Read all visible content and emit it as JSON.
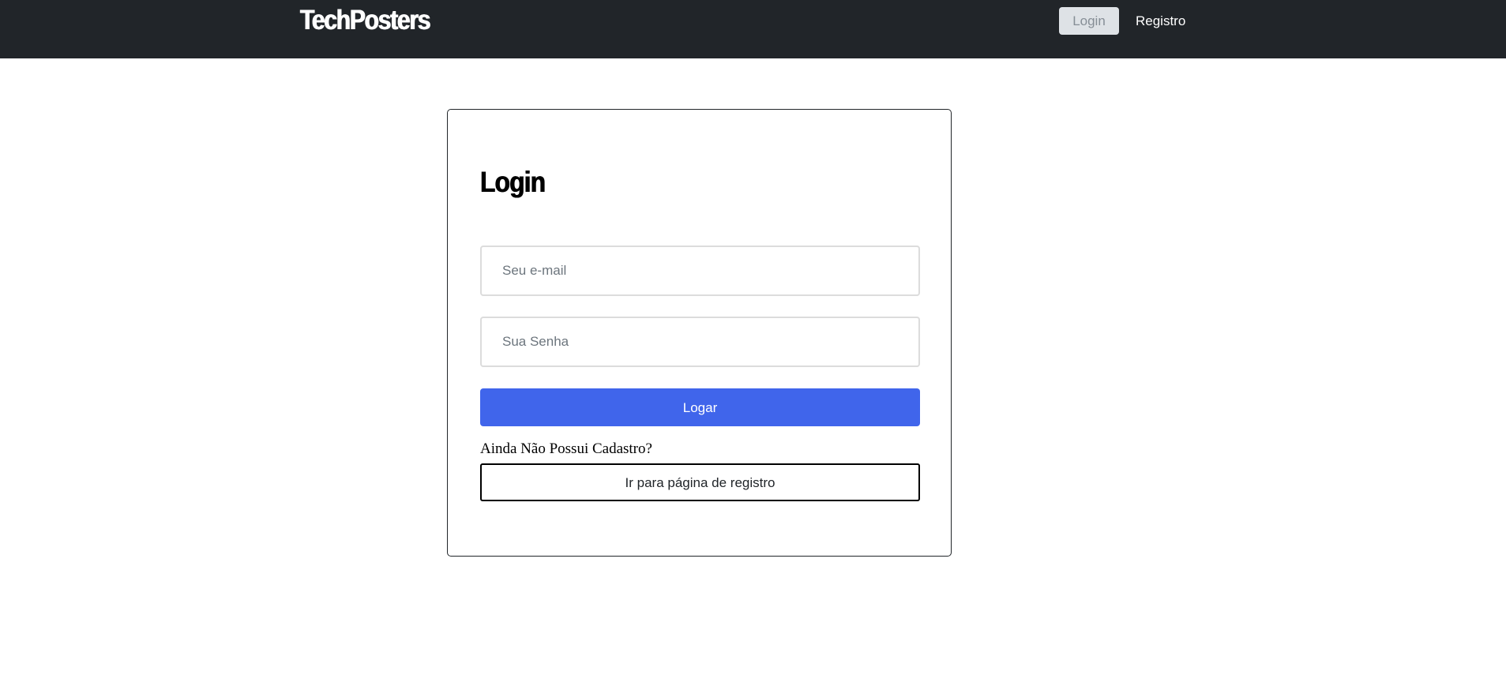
{
  "navbar": {
    "brand": "TechPosters",
    "links": [
      {
        "label": "Login",
        "active": true
      },
      {
        "label": "Registro",
        "active": false
      }
    ],
    "background_color": "#212529"
  },
  "login_card": {
    "title": "Login",
    "email_placeholder": "Seu e-mail",
    "password_placeholder": "Sua Senha",
    "submit_label": "Logar",
    "register_prompt": "Ainda Não Possui Cadastro?",
    "register_button_label": "Ir para página de registro",
    "accent_color": "#4065eb"
  }
}
